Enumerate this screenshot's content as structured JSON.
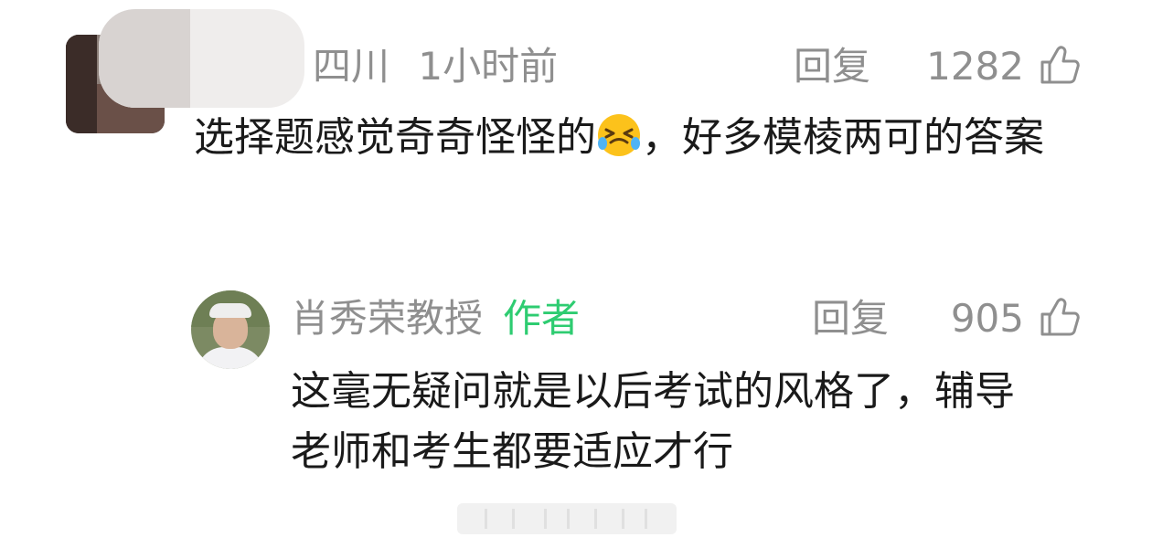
{
  "comment": {
    "location": "四川",
    "time": "1小时前",
    "reply_label": "回复",
    "likes": "1282",
    "text_before_emoji": "选择题感觉奇奇怪怪的",
    "emoji": "crying-laughing-emoji",
    "text_after_emoji": "，好多模棱两可的答案"
  },
  "reply": {
    "author": "肖秀荣教授",
    "author_tag": "作者",
    "reply_label": "回复",
    "likes": "905",
    "text": "这毫无疑问就是以后考试的风格了，辅导老师和考生都要适应才行"
  },
  "colors": {
    "meta_gray": "#8f8f8f",
    "author_tag_green": "#2ecc71",
    "text": "#1a1a1a"
  },
  "icons": {
    "like": "thumbs-up-icon"
  }
}
